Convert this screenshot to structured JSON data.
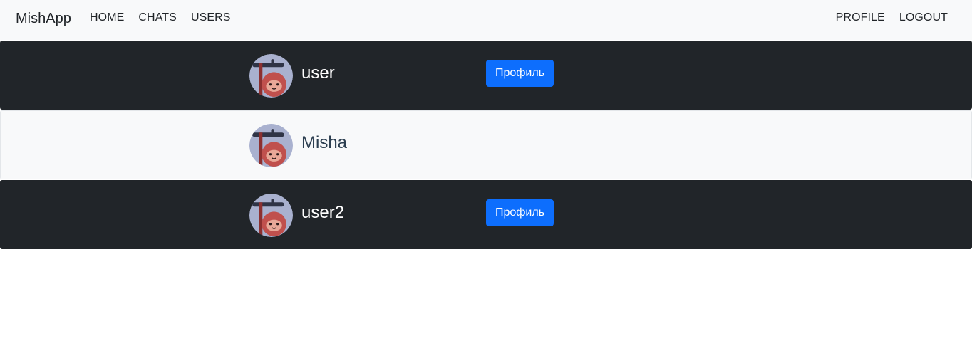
{
  "navbar": {
    "brand": "MishApp",
    "left_links": [
      "HOME",
      "CHATS",
      "USERS"
    ],
    "right_links": [
      "PROFILE",
      "LOGOUT"
    ]
  },
  "users": [
    {
      "name": "user",
      "theme": "dark",
      "button_label": "Профиль",
      "avatar_icon": "sloth-avatar-icon"
    },
    {
      "name": "Misha",
      "theme": "light",
      "button_label": "",
      "avatar_icon": "sloth-avatar-icon"
    },
    {
      "name": "user2",
      "theme": "dark",
      "button_label": "Профиль",
      "avatar_icon": "sloth-avatar-icon"
    }
  ],
  "colors": {
    "navbar_bg": "#f8f9fa",
    "dark_row_bg": "#212529",
    "light_row_bg": "#f8f9fa",
    "button_primary": "#0d6efd"
  }
}
